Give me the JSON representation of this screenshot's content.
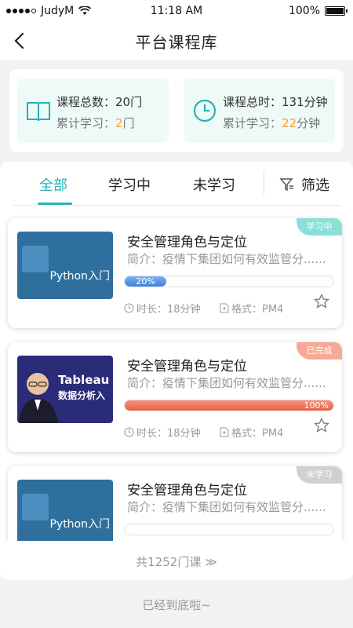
{
  "status_bar": {
    "carrier": "JudyM",
    "time": "11:18 AM",
    "battery": "100%"
  },
  "nav": {
    "title": "平台课程库"
  },
  "stats": {
    "course_total_label": "课程总数：",
    "course_total_value": "20门",
    "learned_courses_label": "累计学习：",
    "learned_courses_value": "2",
    "learned_courses_unit": "门",
    "time_total_label": "课程总时：",
    "time_total_value": "131分钟",
    "learned_time_label": "累计学习：",
    "learned_time_value": "22",
    "learned_time_unit": "分钟"
  },
  "tabs": {
    "all": "全部",
    "learning": "学习中",
    "not_learned": "未学习",
    "filter": "筛选"
  },
  "courses": [
    {
      "title": "安全管理角色与定位",
      "desc": "简介：疫情下集团如何有效监管分......",
      "progress": 20,
      "progress_label": "20%",
      "duration": "时长：18分钟",
      "format": "格式：PM4",
      "badge": "学习中",
      "thumb_text": "Python入门"
    },
    {
      "title": "安全管理角色与定位",
      "desc": "简介：疫情下集团如何有效监管分......",
      "progress": 100,
      "progress_label": "100%",
      "duration": "时长：18分钟",
      "format": "格式：PM4",
      "badge": "已完成",
      "thumb_text_1": "Tableau",
      "thumb_text_2": "数据分析入"
    },
    {
      "title": "安全管理角色与定位",
      "desc": "简介：疫情下集团如何有效监管分......",
      "progress": 0,
      "badge": "未学习",
      "thumb_text": "Python入门"
    }
  ],
  "footer": {
    "total": "共1252门课 ≫",
    "end": "已经到底啦~"
  },
  "colors": {
    "accent": "#27b3b3",
    "highlight": "#f5a623",
    "progress_blue": "#3d7fdc",
    "progress_red": "#e95e43"
  }
}
